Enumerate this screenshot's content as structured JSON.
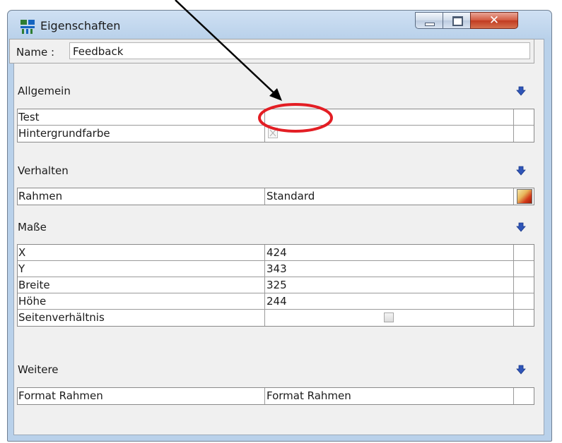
{
  "window": {
    "title": "Eigenschaften"
  },
  "icons": {
    "app": "properties-app-icon",
    "section_toggle": "blue-down-arrow-icon",
    "edit": "color-picker-edit-icon"
  },
  "colors": {
    "annotation_circle": "#e31e24",
    "annotation_arrow": "#000000",
    "section_arrow": "#2f55b8"
  },
  "name_row": {
    "label": "Name :",
    "value": "Feedback"
  },
  "sections": {
    "allgemein": {
      "title": "Allgemein",
      "rows": [
        {
          "label": "Test",
          "value": ""
        },
        {
          "label": "Hintergrundfarbe",
          "value": ""
        }
      ]
    },
    "verhalten": {
      "title": "Verhalten",
      "rows": [
        {
          "label": "Rahmen",
          "value": "Standard"
        }
      ]
    },
    "masse": {
      "title": "Maße",
      "rows": [
        {
          "label": "X",
          "value": "424"
        },
        {
          "label": "Y",
          "value": "343"
        },
        {
          "label": "Breite",
          "value": "325"
        },
        {
          "label": "Höhe",
          "value": "244"
        },
        {
          "label": "Seitenverhältnis",
          "value": ""
        }
      ]
    },
    "weitere": {
      "title": "Weitere",
      "rows": [
        {
          "label": "Format Rahmen",
          "value": "Format Rahmen"
        }
      ]
    }
  }
}
